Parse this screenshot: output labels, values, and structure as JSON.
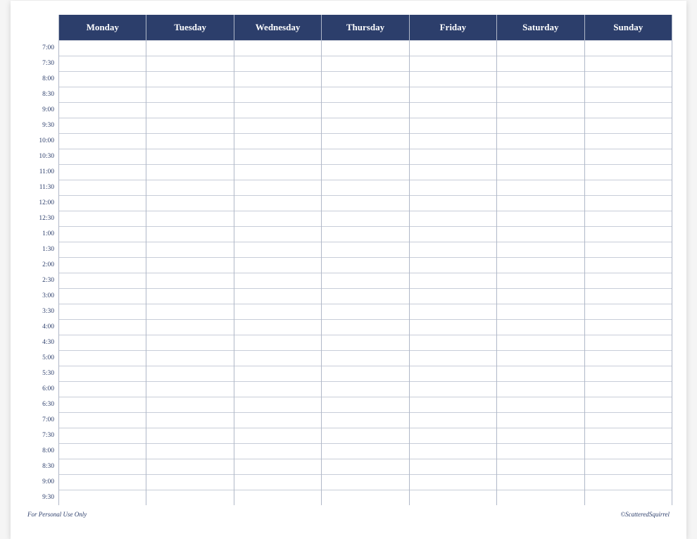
{
  "header": {
    "days": [
      "Monday",
      "Tuesday",
      "Wednesday",
      "Thursday",
      "Friday",
      "Saturday",
      "Sunday"
    ]
  },
  "times": [
    "7:00",
    "7:30",
    "8:00",
    "8:30",
    "9:00",
    "9:30",
    "10:00",
    "10:30",
    "11:00",
    "11:30",
    "12:00",
    "12:30",
    "1:00",
    "1:30",
    "2:00",
    "2:30",
    "3:00",
    "3:30",
    "4:00",
    "4:30",
    "5:00",
    "5:30",
    "6:00",
    "6:30",
    "7:00",
    "7:30",
    "8:00",
    "8:30",
    "9:00",
    "9:30"
  ],
  "footer": {
    "left": "For Personal Use Only",
    "right": "©ScatteredSquirrel"
  }
}
